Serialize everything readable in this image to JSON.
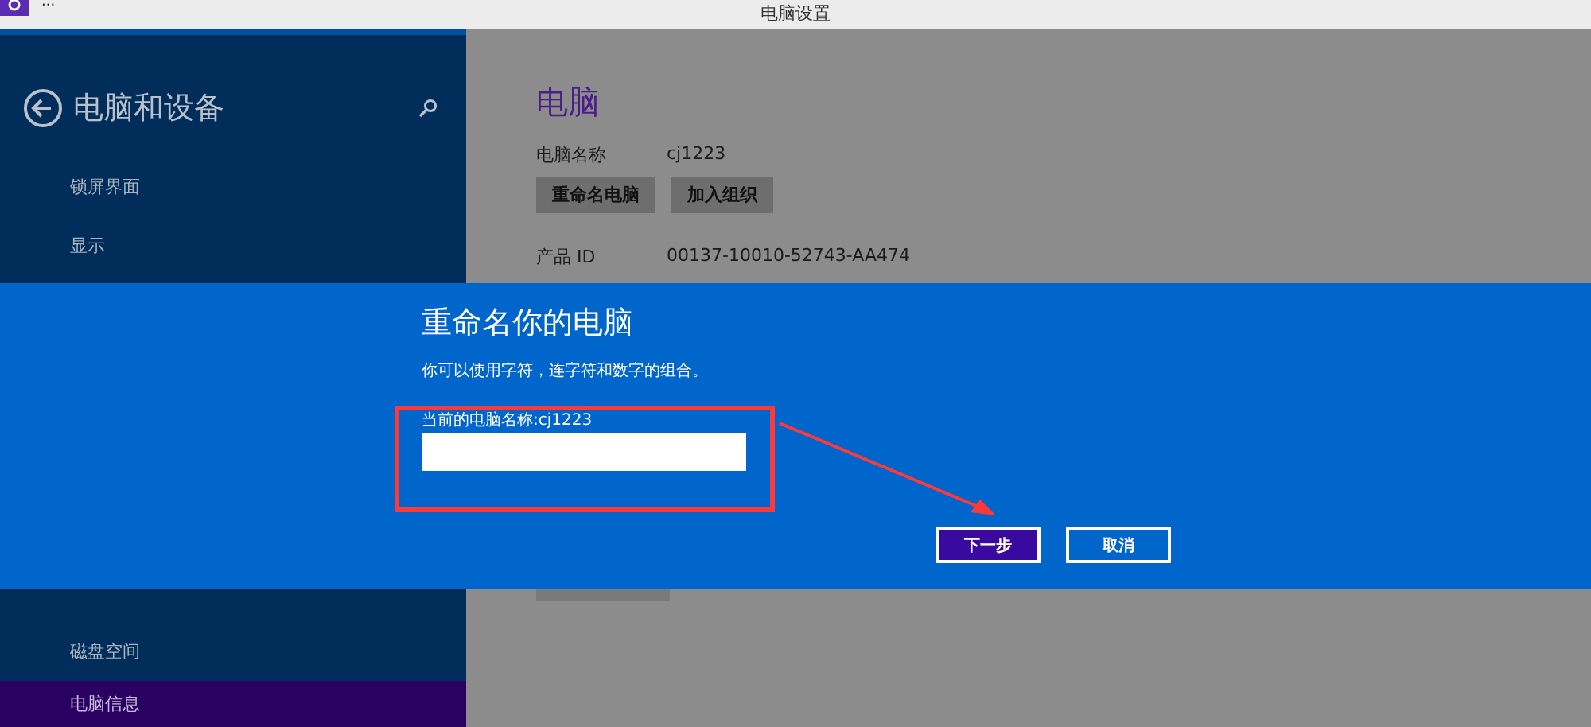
{
  "window": {
    "title": "电脑设置",
    "menu_glyph": "···"
  },
  "sidebar": {
    "title": "电脑和设备",
    "items_top": [
      {
        "label": "锁屏界面",
        "selected": false
      },
      {
        "label": "显示",
        "selected": false
      }
    ],
    "items_bottom": [
      {
        "label": "磁盘空间",
        "selected": false
      },
      {
        "label": "电脑信息",
        "selected": true
      }
    ]
  },
  "content": {
    "title": "电脑",
    "name_label": "电脑名称",
    "name_value": "cj1223",
    "buttons": [
      "重命名电脑",
      "加入组织"
    ],
    "product_label": "产品 ID",
    "product_value": "00137-10010-52743-AA474"
  },
  "dialog": {
    "title": "重命名你的电脑",
    "hint": "你可以使用字符，连字符和数字的组合。",
    "field_label": "当前的电脑名称:cj1223",
    "buttons": [
      {
        "label": "下一步",
        "kind": "primary"
      },
      {
        "label": "取消",
        "kind": "secondary"
      }
    ]
  }
}
